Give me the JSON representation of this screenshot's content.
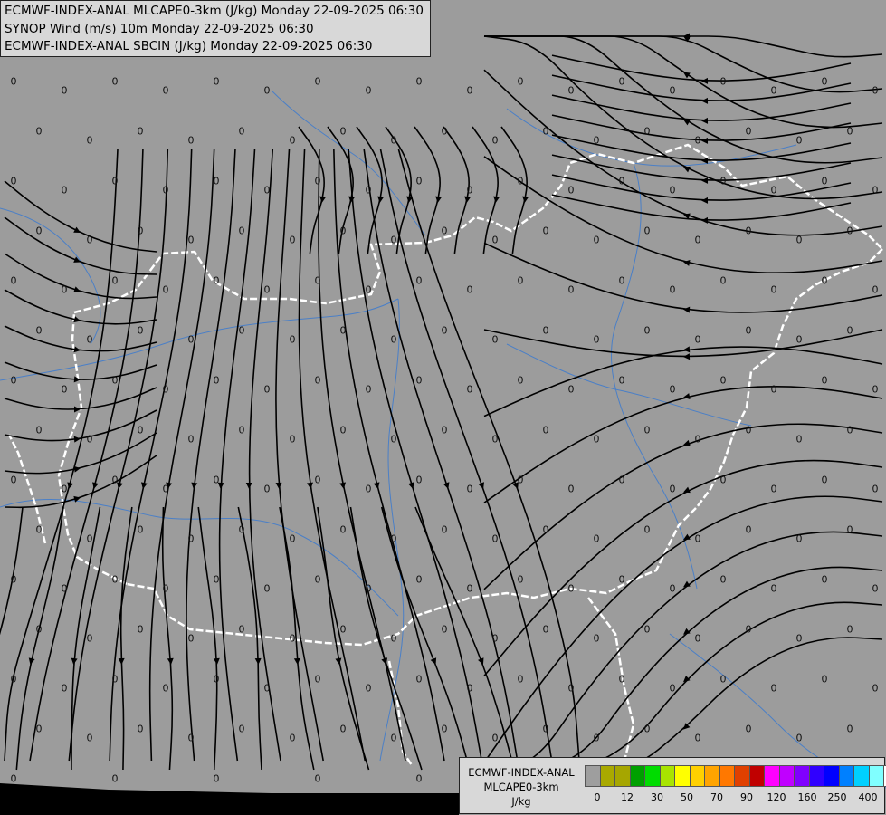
{
  "header": {
    "line1": "ECMWF-INDEX-ANAL MLCAPE0-3km (J/kg) Monday 22-09-2025 06:30",
    "line2": "SYNOP Wind (m/s) 10m Monday 22-09-2025 06:30",
    "line3": "ECMWF-INDEX-ANAL SBCIN (J/kg) Monday 22-09-2025 06:30"
  },
  "legend": {
    "line1": "ECMWF-INDEX-ANAL",
    "line2": "MLCAPE0-3km",
    "line3": "J/kg",
    "colors": [
      "#9e9e9e",
      "#a9a900",
      "#a6a600",
      "#00a000",
      "#00dc00",
      "#a8e400",
      "#ffff00",
      "#ffd000",
      "#ffa400",
      "#ff7800",
      "#e04000",
      "#c00000",
      "#ff00ff",
      "#c000ff",
      "#8000ff",
      "#3000ff",
      "#0000ff",
      "#0080ff",
      "#00d0ff",
      "#80ffff",
      "#ffffff"
    ],
    "tick_labels": [
      "0",
      "12",
      "30",
      "50",
      "70",
      "90",
      "120",
      "160",
      "250",
      "400"
    ]
  },
  "map_colors": {
    "background": "#9c9c9c",
    "border": "#ffffff",
    "river": "#4a7fc7",
    "streamline": "#000000"
  },
  "cin_value": "0"
}
